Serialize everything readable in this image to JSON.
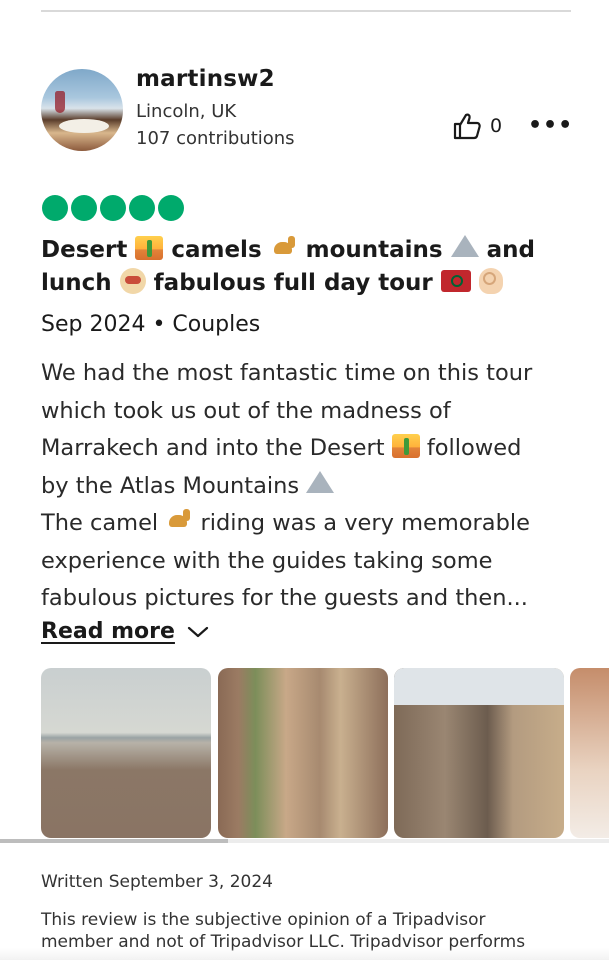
{
  "reviewer": {
    "username": "martinsw2",
    "location": "Lincoln, UK",
    "contributions": "107 contributions"
  },
  "actions": {
    "helpful_count": "0",
    "helpful_icon": "thumbs-up-icon",
    "more_icon": "more-options-icon",
    "more_glyph": "•••"
  },
  "rating": {
    "value": 5,
    "max": 5,
    "color": "#00aa6c"
  },
  "review": {
    "title_parts": [
      "Desert ",
      " camels ",
      " mountains ",
      " and lunch ",
      " fabulous full day tour "
    ],
    "meta": "Sep 2024 • Couples",
    "body": {
      "l1": "We had the most fantastic time on this tour",
      "l2": "which took us out of the madness of",
      "l3a": "Marrakech and into the Desert ",
      "l3b": " followed",
      "l4": "by the Atlas Mountains ",
      "l5a": "The camel ",
      "l5b": " riding was a very memorable",
      "l6": "experience with the guides taking some",
      "l7": "fabulous pictures for the guests and then..."
    },
    "read_more": "Read more",
    "written": "Written September 3, 2024"
  },
  "disclaimer": {
    "l1": "This review is the subjective opinion of a Tripadvisor",
    "l2": "member and not of Tripadvisor LLC. Tripadvisor performs"
  }
}
